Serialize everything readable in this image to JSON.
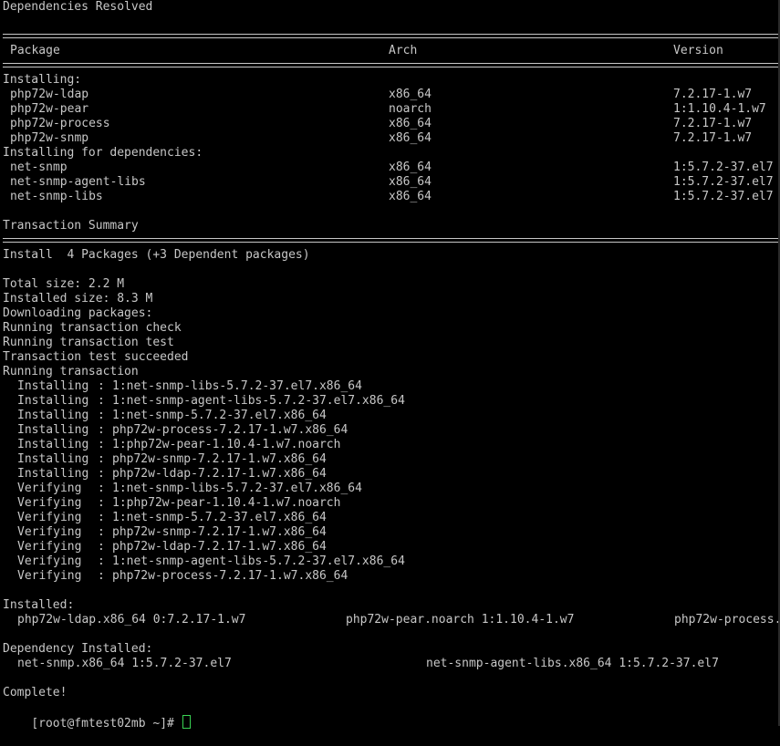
{
  "terminal": {
    "header": "Dependencies Resolved",
    "table": {
      "columns": [
        "Package",
        "Arch",
        "Version"
      ],
      "installing_label": "Installing:",
      "installing": [
        {
          "package": "php72w-ldap",
          "arch": "x86_64",
          "version": "7.2.17-1.w7"
        },
        {
          "package": "php72w-pear",
          "arch": "noarch",
          "version": "1:1.10.4-1.w7"
        },
        {
          "package": "php72w-process",
          "arch": "x86_64",
          "version": "7.2.17-1.w7"
        },
        {
          "package": "php72w-snmp",
          "arch": "x86_64",
          "version": "7.2.17-1.w7"
        }
      ],
      "deps_label": "Installing for dependencies:",
      "dependencies": [
        {
          "package": "net-snmp",
          "arch": "x86_64",
          "version": "1:5.7.2-37.el7"
        },
        {
          "package": "net-snmp-agent-libs",
          "arch": "x86_64",
          "version": "1:5.7.2-37.el7"
        },
        {
          "package": "net-snmp-libs",
          "arch": "x86_64",
          "version": "1:5.7.2-37.el7"
        }
      ]
    },
    "summary_label": "Transaction Summary",
    "install_line": "Install  4 Packages (+3 Dependent packages)",
    "log": [
      "Total size: 2.2 M",
      "Installed size: 8.3 M",
      "Downloading packages:",
      "Running transaction check",
      "Running transaction test",
      "Transaction test succeeded",
      "Running transaction"
    ],
    "steps": [
      {
        "action": "Installing",
        "sep": ":",
        "target": "1:net-snmp-libs-5.7.2-37.el7.x86_64"
      },
      {
        "action": "Installing",
        "sep": ":",
        "target": "1:net-snmp-agent-libs-5.7.2-37.el7.x86_64"
      },
      {
        "action": "Installing",
        "sep": ":",
        "target": "1:net-snmp-5.7.2-37.el7.x86_64"
      },
      {
        "action": "Installing",
        "sep": ":",
        "target": "php72w-process-7.2.17-1.w7.x86_64"
      },
      {
        "action": "Installing",
        "sep": ":",
        "target": "1:php72w-pear-1.10.4-1.w7.noarch"
      },
      {
        "action": "Installing",
        "sep": ":",
        "target": "php72w-snmp-7.2.17-1.w7.x86_64"
      },
      {
        "action": "Installing",
        "sep": ":",
        "target": "php72w-ldap-7.2.17-1.w7.x86_64"
      },
      {
        "action": "Verifying ",
        "sep": ":",
        "target": "1:net-snmp-libs-5.7.2-37.el7.x86_64"
      },
      {
        "action": "Verifying ",
        "sep": ":",
        "target": "1:php72w-pear-1.10.4-1.w7.noarch"
      },
      {
        "action": "Verifying ",
        "sep": ":",
        "target": "1:net-snmp-5.7.2-37.el7.x86_64"
      },
      {
        "action": "Verifying ",
        "sep": ":",
        "target": "php72w-snmp-7.2.17-1.w7.x86_64"
      },
      {
        "action": "Verifying ",
        "sep": ":",
        "target": "php72w-ldap-7.2.17-1.w7.x86_64"
      },
      {
        "action": "Verifying ",
        "sep": ":",
        "target": "1:net-snmp-agent-libs-5.7.2-37.el7.x86_64"
      },
      {
        "action": "Verifying ",
        "sep": ":",
        "target": "php72w-process-7.2.17-1.w7.x86_64"
      }
    ],
    "installed_label": "Installed:",
    "installed": [
      "php72w-ldap.x86_64 0:7.2.17-1.w7",
      "php72w-pear.noarch 1:1.10.4-1.w7",
      "php72w-process."
    ],
    "dep_installed_label": "Dependency Installed:",
    "dep_installed": [
      "net-snmp.x86_64 1:5.7.2-37.el7",
      "net-snmp-agent-libs.x86_64 1:5.7.2-37.el7"
    ],
    "complete": "Complete!",
    "prompt": "[root@fmtest02mb ~]# "
  },
  "colors": {
    "background": "#000000",
    "text": "#c7c7c7",
    "cursor": "#39d353"
  }
}
